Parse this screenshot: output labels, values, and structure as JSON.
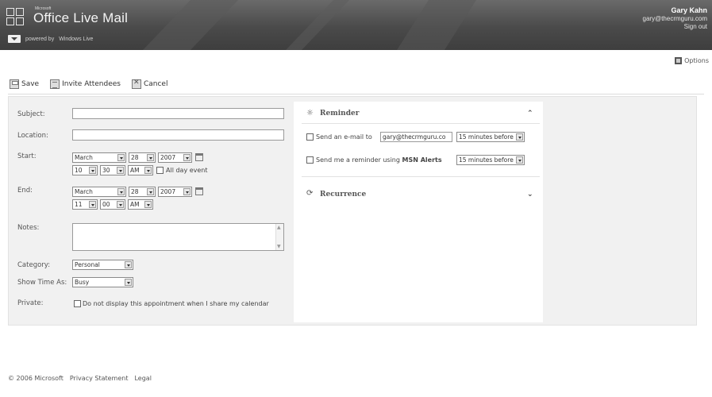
{
  "header": {
    "microsoft_small": "Microsoft",
    "app_name": "Office Live Mail",
    "powered_by": "powered by",
    "windows_live": "Windows Live",
    "user_name": "Gary Kahn",
    "user_email": "gary@thecrmguru.com",
    "sign_out": "Sign out"
  },
  "options": {
    "label": "Options"
  },
  "toolbar": {
    "save": "Save",
    "invite": "Invite Attendees",
    "cancel": "Cancel"
  },
  "form": {
    "subject_label": "Subject:",
    "subject_value": "",
    "location_label": "Location:",
    "location_value": "",
    "start_label": "Start:",
    "start": {
      "month": "March",
      "day": "28",
      "year": "2007",
      "hour": "10",
      "minute": "30",
      "ampm": "AM"
    },
    "all_day": "All day event",
    "end_label": "End:",
    "end": {
      "month": "March",
      "day": "28",
      "year": "2007",
      "hour": "11",
      "minute": "00",
      "ampm": "AM"
    },
    "notes_label": "Notes:",
    "category_label": "Category:",
    "category_value": "Personal",
    "show_time_label": "Show Time As:",
    "show_time_value": "Busy",
    "private_label": "Private:",
    "private_text": "Do not display this appointment when I share my calendar"
  },
  "reminder": {
    "title": "Reminder",
    "email_label": "Send an e-mail to",
    "email_value": "gary@thecrmguru.co",
    "email_when": "15 minutes before",
    "msn_label_pre": "Send me a reminder using",
    "msn_label_bold": "MSN Alerts",
    "msn_when": "15 minutes before"
  },
  "recurrence": {
    "title": "Recurrence"
  },
  "footer": {
    "copyright": "© 2006 Microsoft",
    "privacy": "Privacy Statement",
    "legal": "Legal"
  }
}
